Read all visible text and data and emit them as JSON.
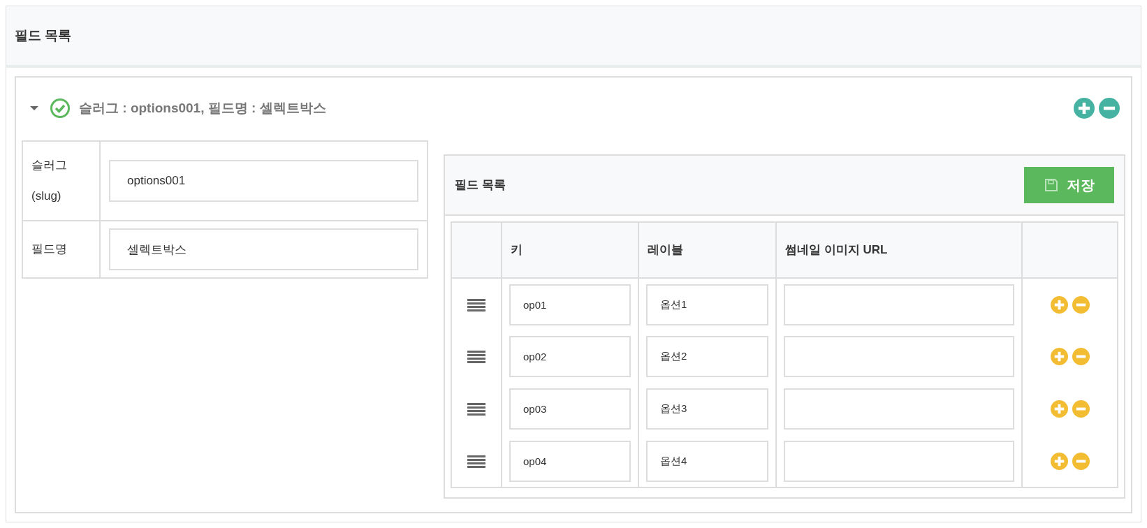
{
  "header": {
    "title": "필드 목록"
  },
  "field": {
    "expanded": true,
    "valid": true,
    "summary": "슬러그 : options001, 필드명 : 셀렉트박스",
    "settings": [
      {
        "label": "슬러그 (slug)",
        "value": "options001"
      },
      {
        "label": "필드명",
        "value": "셀렉트박스"
      }
    ],
    "options": {
      "title": "필드 목록",
      "save": "저장",
      "columns": [
        "키",
        "레이블",
        "썸네일 이미지 URL"
      ],
      "rows": [
        {
          "key": "op01",
          "label": "옵션1"
        },
        {
          "key": "op02",
          "label": "옵션2"
        },
        {
          "key": "op03",
          "label": "옵션3"
        },
        {
          "key": "op04",
          "label": "옵션4"
        }
      ]
    }
  }
}
